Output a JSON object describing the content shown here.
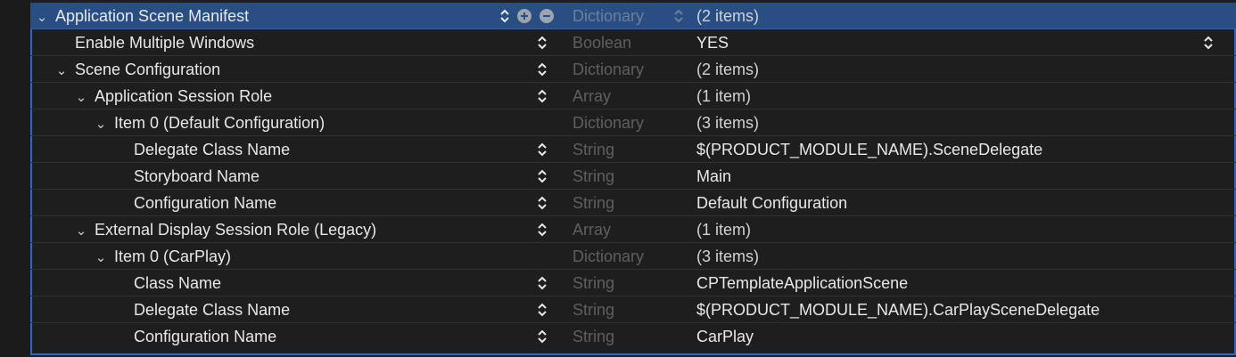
{
  "rows": [
    {
      "key": "Application Scene Manifest",
      "type": "Dictionary",
      "value": "(2 items)"
    },
    {
      "key": "Enable Multiple Windows",
      "type": "Boolean",
      "value": "YES"
    },
    {
      "key": "Scene Configuration",
      "type": "Dictionary",
      "value": "(2 items)"
    },
    {
      "key": "Application Session Role",
      "type": "Array",
      "value": "(1 item)"
    },
    {
      "key": "Item 0 (Default Configuration)",
      "type": "Dictionary",
      "value": "(3 items)"
    },
    {
      "key": "Delegate Class Name",
      "type": "String",
      "value": "$(PRODUCT_MODULE_NAME).SceneDelegate"
    },
    {
      "key": "Storyboard Name",
      "type": "String",
      "value": "Main"
    },
    {
      "key": "Configuration Name",
      "type": "String",
      "value": "Default Configuration"
    },
    {
      "key": "External Display Session Role (Legacy)",
      "type": "Array",
      "value": "(1 item)"
    },
    {
      "key": "Item 0 (CarPlay)",
      "type": "Dictionary",
      "value": "(3 items)"
    },
    {
      "key": "Class Name",
      "type": "String",
      "value": "CPTemplateApplicationScene"
    },
    {
      "key": "Delegate Class Name",
      "type": "String",
      "value": "$(PRODUCT_MODULE_NAME).CarPlaySceneDelegate"
    },
    {
      "key": "Configuration Name",
      "type": "String",
      "value": "CarPlay"
    }
  ],
  "icons": {
    "disclosure": "chevron-down-icon",
    "stepper": "up-down-icon",
    "add": "plus-circle-icon",
    "remove": "minus-circle-icon"
  },
  "colors": {
    "selection": "#284e82",
    "border": "#2f66c8",
    "type_text": "#5f5f5f",
    "background": "#1e1e1e"
  }
}
